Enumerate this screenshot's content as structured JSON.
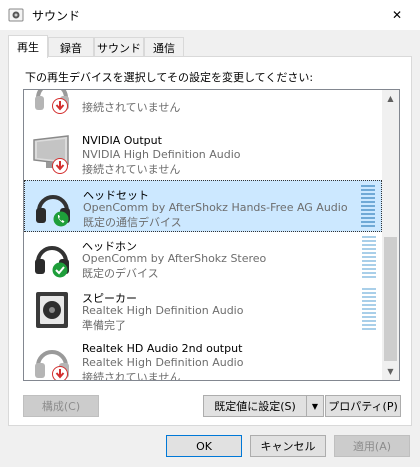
{
  "window": {
    "title": "サウンド",
    "close_glyph": "✕"
  },
  "tabs": [
    {
      "label": "再生",
      "active": true
    },
    {
      "label": "録音",
      "active": false
    },
    {
      "label": "サウンド",
      "active": false
    },
    {
      "label": "通信",
      "active": false
    }
  ],
  "instruction": "下の再生デバイスを選択してその設定を変更してください:",
  "devices": [
    {
      "name": "",
      "description": "",
      "status": "接続されていません",
      "icon": "headphones-icon",
      "badge": "red-down-arrow-badge"
    },
    {
      "name": "NVIDIA Output",
      "description": "NVIDIA High Definition Audio",
      "status": "接続されていません",
      "icon": "monitor-icon",
      "badge": "red-down-arrow-badge"
    },
    {
      "name": "ヘッドセット",
      "description": "OpenComm by AfterShokz Hands-Free AG Audio",
      "status": "既定の通信デバイス",
      "icon": "headset-icon",
      "badge": "green-phone-badge",
      "selected": true
    },
    {
      "name": "ヘッドホン",
      "description": "OpenComm by AfterShokz Stereo",
      "status": "既定のデバイス",
      "icon": "headphones-icon",
      "badge": "green-check-badge"
    },
    {
      "name": "スピーカー",
      "description": "Realtek High Definition Audio",
      "status": "準備完了",
      "icon": "speaker-icon",
      "badge": ""
    },
    {
      "name": "Realtek HD Audio 2nd output",
      "description": "Realtek High Definition Audio",
      "status": "接続されていません",
      "icon": "headphones-icon",
      "badge": "red-down-arrow-badge"
    }
  ],
  "buttons": {
    "configure": "構成(C)",
    "set_default": "既定値に設定(S)",
    "properties": "プロパティ(P)",
    "ok": "OK",
    "cancel": "キャンセル",
    "apply": "適用(A)"
  },
  "colors": {
    "selection": "#cce8ff",
    "red_badge": "#d32f2f",
    "green_badge": "#1e9e3a",
    "level_meter": "#a9cfe9"
  }
}
